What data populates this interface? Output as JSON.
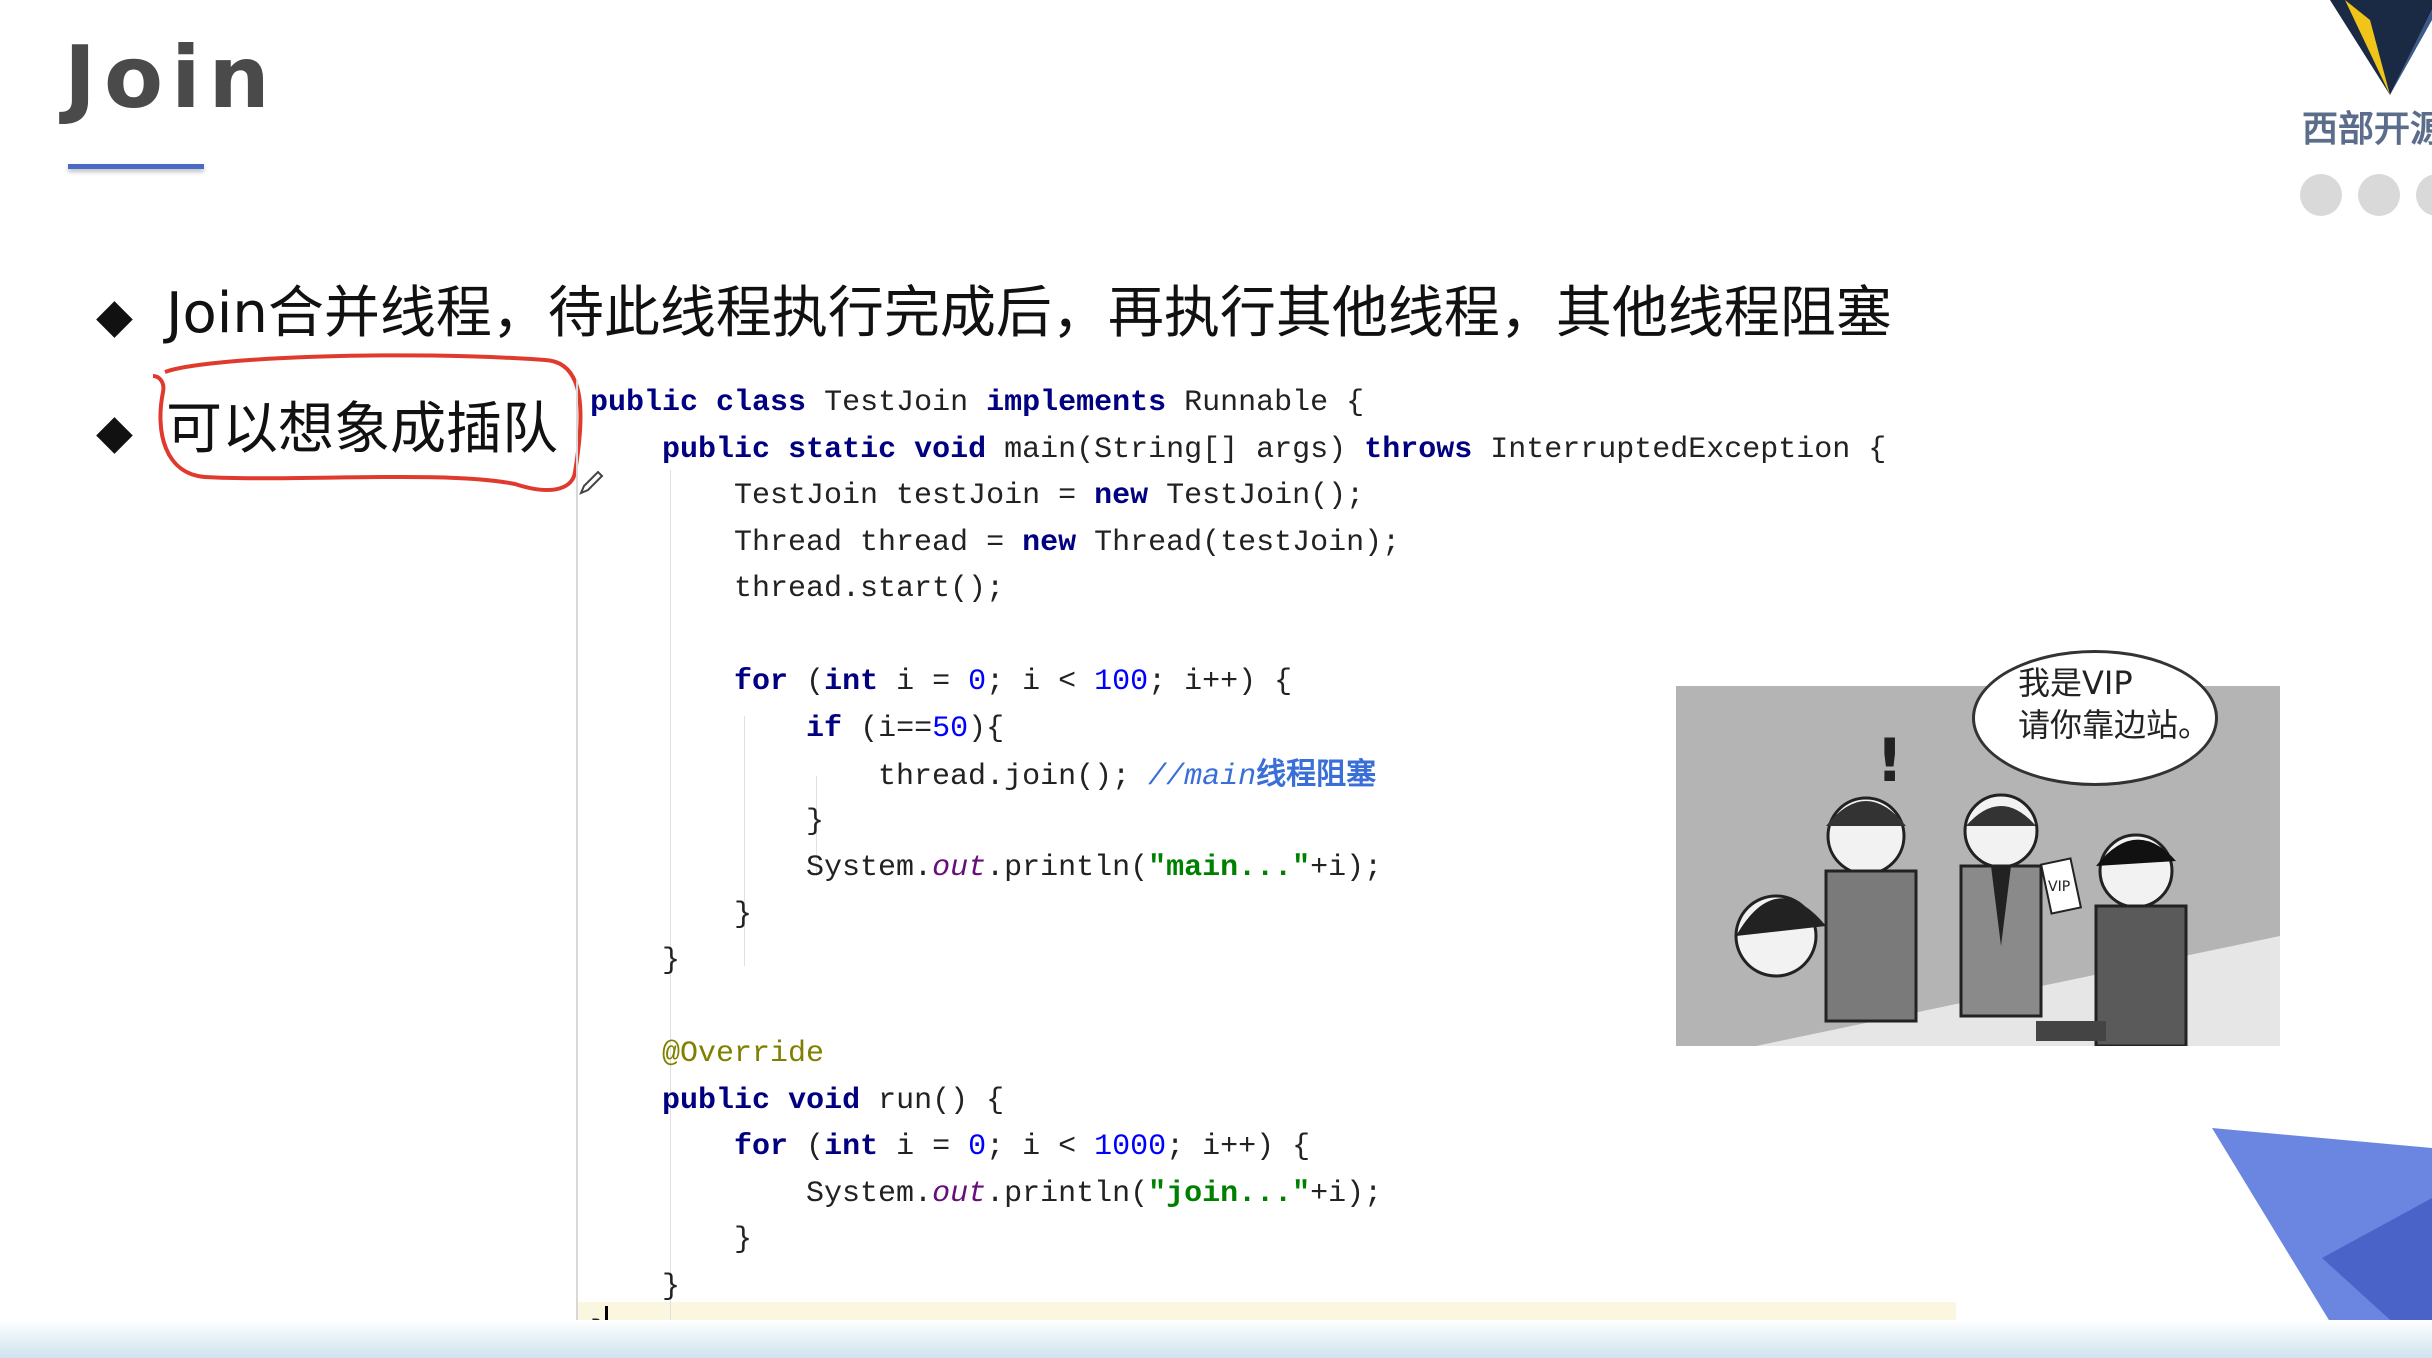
{
  "slide": {
    "title": "Join",
    "bullets": [
      "Join合并线程，待此线程执行完成后，再执行其他线程，其他线程阻塞",
      "可以想象成插队"
    ],
    "bullet_glyph": "◆"
  },
  "logo": {
    "text": "西部开源"
  },
  "code": {
    "lines": [
      "public class TestJoin implements Runnable {",
      "    public static void main(String[] args) throws InterruptedException {",
      "        TestJoin testJoin = new TestJoin();",
      "        Thread thread = new Thread(testJoin);",
      "        thread.start();",
      "",
      "        for (int i = 0; i < 100; i++) {",
      "            if (i==50){",
      "                thread.join(); //main线程阻塞",
      "            }",
      "            System.out.println(\"main...\"+i);",
      "        }",
      "    }",
      "",
      "    @Override",
      "    public void run() {",
      "        for (int i = 0; i < 1000; i++) {",
      "            System.out.println(\"join...\"+i);",
      "        }",
      "    }",
      "}"
    ],
    "comment": "//main线程阻塞"
  },
  "cartoon": {
    "speech_line1": "我是VIP",
    "speech_line2": "请你靠边站。",
    "ticket_label": "VIP"
  },
  "colors": {
    "keyword": "#000080",
    "number": "#0000ff",
    "string": "#008000",
    "comment": "#3a6fd8",
    "annotation": "#808000",
    "accent": "#4a6bc4",
    "annotation_circle": "#e03a2e"
  }
}
